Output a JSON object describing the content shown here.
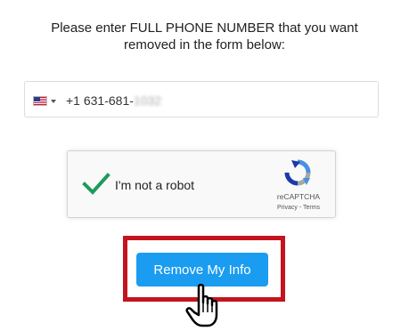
{
  "instructions": {
    "line1": "Please enter FULL PHONE NUMBER that you want",
    "line2": "removed in the form below:"
  },
  "phone": {
    "country_flag": "us-flag-icon",
    "visible_value": "+1 631-681-",
    "redacted_part": "1032"
  },
  "recaptcha": {
    "checkbox_label": "I'm not a robot",
    "checked": true,
    "brand": "reCAPTCHA",
    "privacy_link": "Privacy",
    "separator": " - ",
    "terms_link": "Terms"
  },
  "submit": {
    "label": "Remove My Info"
  },
  "colors": {
    "button": "#1a9cf0",
    "highlight": "#c4141e",
    "check": "#1e9b5a"
  }
}
